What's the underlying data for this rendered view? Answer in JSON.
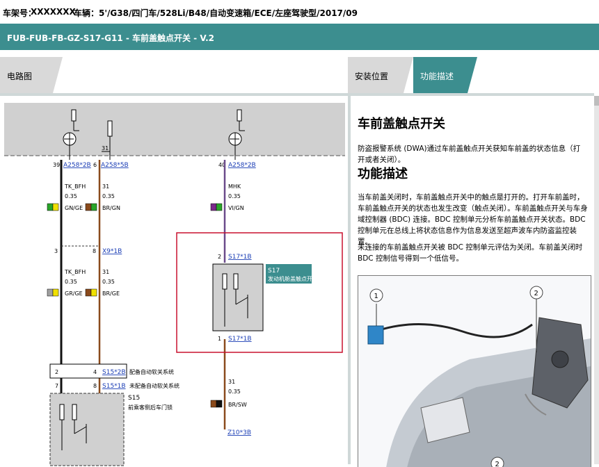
{
  "vehicle_bar": {
    "vin_label": "车架号：",
    "vin_value": "XXXXXXX",
    "vehicle_label": "车辆：",
    "vehicle_value": "5'/G38/四门车/528Li/B48/自动变速箱/ECE/左座驾驶型/2017/09"
  },
  "document_title": "FUB-FUB-FB-GZ-S17-G11 - 车前盖触点开关 - V.2",
  "tabs": {
    "wiring": "电路图",
    "install": "安装位置",
    "function": "功能描述"
  },
  "diagram": {
    "conn_a1": "39",
    "conn_a1_id": "A258*2B",
    "conn_a2": "6",
    "conn_a2_id": "A258*5B",
    "conn_a3": "40",
    "conn_a3_id": "A258*2B",
    "label_31_top": "31",
    "w1_name": "TK_BFH",
    "w1_size": "0.35",
    "w1_color": "GN/GE",
    "w2_name": "31",
    "w2_size": "0.35",
    "w2_color": "BR/GN",
    "w3_name": "MHK",
    "w3_size": "0.35",
    "w3_color": "VI/GN",
    "x9_pin_left": "3",
    "x9_pin_right": "8",
    "x9_id": "X9*1B",
    "w4_name": "TK_BFH",
    "w4_size": "0.35",
    "w4_color": "GR/GE",
    "w5_name": "31",
    "w5_size": "0.35",
    "w5_color": "BR/GE",
    "s17_pin_top": "2",
    "s17_top_id": "S17*1B",
    "s17_name": "S17",
    "s17_desc": "发动机舱盖触点开关",
    "s17_pin_bottom": "1",
    "s17_bottom_id": "S17*1B",
    "s15_pin_a_left": "2",
    "s15_pin_a_right": "4",
    "s15_id_a": "S15*2B",
    "s15_desc_a": "配备自动软关系统",
    "s15_pin_b_left": "7",
    "s15_pin_b_right": "8",
    "s15_id_b": "S15*1B",
    "s15_desc_b": "未配备自动软关系统",
    "s15_name": "S15",
    "s15_desc": "前乘客侧后车门锁",
    "w6_name": "31",
    "w6_size": "0.35",
    "w6_color": "BR/SW",
    "z_id": "Z10*3B",
    "color_green": "#2aa52a",
    "color_yellow": "#f0e000",
    "color_brown": "#8a4a1c",
    "color_violet": "#7a2a8a",
    "color_gray": "#a0a0a0",
    "highlight_red": "#c8102e"
  },
  "description": {
    "heading": "车前盖触点开关",
    "intro": "防盗报警系统 (DWA)通过车前盖触点开关获知车前盖的状态信息（打开或者关闭）。",
    "function_heading": "功能描述",
    "para1": "当车前盖关闭时，车前盖触点开关中的触点是打开的。打开车前盖时，车前盖触点开关的状态也发生改变（触点关闭）。车前盖触点开关与车身域控制器 (BDC) 连接。BDC 控制单元分析车前盖触点开关状态。BDC 控制单元在总线上将状态信息作为信息发送至超声波车内防盗监控装置。",
    "para2": "未连接的车前盖触点开关被 BDC 控制单元评估为关闭。车前盖关闭时 BDC 控制信号得到一个低信号。",
    "callout_1": "1",
    "callout_2a": "2",
    "callout_2b": "2"
  }
}
